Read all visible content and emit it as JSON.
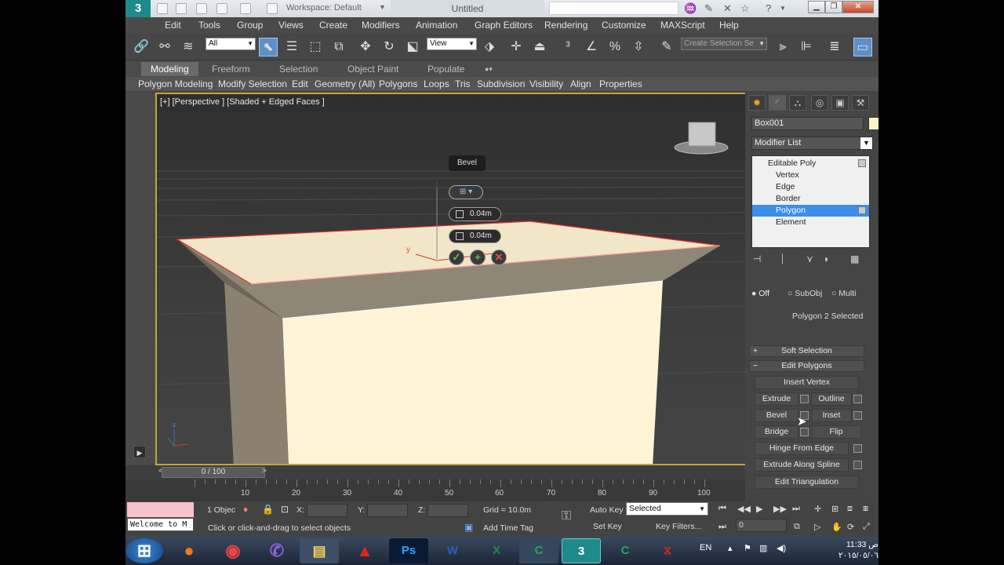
{
  "title_bar": {
    "logo": "3",
    "workspace": "Workspace: Default",
    "doc_title": "Untitled"
  },
  "menu": [
    "Edit",
    "Tools",
    "Group",
    "Views",
    "Create",
    "Modifiers",
    "Animation",
    "Graph Editors",
    "Rendering",
    "Customize",
    "MAXScript",
    "Help"
  ],
  "toolbar": {
    "selection_filter": "All",
    "ref_coord": "View",
    "create_selection_set": "Create Selection Se"
  },
  "ribbon": {
    "tabs": [
      "Modeling",
      "Freeform",
      "Selection",
      "Object Paint",
      "Populate"
    ],
    "active_tab": "Modeling",
    "subtabs": [
      "Polygon Modeling",
      "Modify Selection",
      "Edit",
      "Geometry (All)",
      "Polygons",
      "Loops",
      "Tris",
      "Subdivision",
      "Visibility",
      "Align",
      "Properties"
    ]
  },
  "viewport": {
    "label": "[+] [Perspective ] [Shaded + Edged Faces ]",
    "axis_x": "x",
    "axis_y": "y",
    "axis_z": "z"
  },
  "caddy": {
    "title": "Bevel",
    "height_value": "0.04m",
    "outline_value": "0.04m"
  },
  "command_panel": {
    "object_name": "Box001",
    "modifier_list": "Modifier List",
    "stack": {
      "root": "Editable Poly",
      "items": [
        "Vertex",
        "Edge",
        "Border",
        "Polygon",
        "Element"
      ],
      "selected": "Polygon"
    },
    "preview_selection": {
      "off": "Off",
      "subobj": "SubObj",
      "multi": "Multi"
    },
    "selection_status": "Polygon 2 Selected",
    "soft_selection": "Soft Selection",
    "edit_polygons": "Edit Polygons",
    "buttons": {
      "insert_vertex": "Insert Vertex",
      "extrude": "Extrude",
      "outline": "Outline",
      "bevel": "Bevel",
      "inset": "Inset",
      "bridge": "Bridge",
      "flip": "Flip",
      "hinge": "Hinge From Edge",
      "extrude_spline": "Extrude Along Spline",
      "edit_triangulation": "Edit Triangulation"
    }
  },
  "timeline": {
    "frame": "0 / 100",
    "ticks": [
      "10",
      "20",
      "30",
      "40",
      "50",
      "60",
      "70",
      "80",
      "90",
      "100"
    ]
  },
  "status": {
    "maxscript": "Welcome to M",
    "selection_count": "1 Objec",
    "x_label": "X:",
    "y_label": "Y:",
    "z_label": "Z:",
    "grid": "Grid = 10.0m",
    "prompt": "Click or click-and-drag to select objects",
    "add_time_tag": "Add Time Tag",
    "auto_key": "Auto Key",
    "anim_mode": "Selected",
    "set_key": "Set Key",
    "key_filters": "Key Filters...",
    "current_frame": "0"
  },
  "taskbar": {
    "lang": "EN",
    "time": "11:33 ص",
    "date": "٢٠١٥/٠٥/٠٦"
  },
  "colors": {
    "viewport_border": "#c6a43a",
    "selection_blue": "#3d8ee8",
    "box_face": "#fff4d6",
    "selected_edge": "#e03030"
  }
}
